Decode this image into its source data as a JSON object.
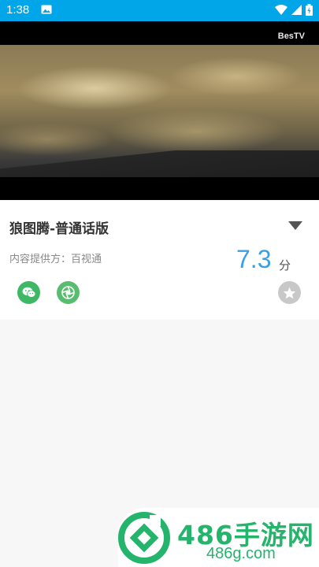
{
  "status_bar": {
    "time": "1:38",
    "bg_color": "#00a6e8",
    "icons": [
      "image-icon",
      "wifi-icon",
      "signal-icon",
      "battery-icon"
    ]
  },
  "video": {
    "logo": "BesTV"
  },
  "info": {
    "title": "狼图腾-普通话版",
    "provider": "内容提供方：百视通",
    "score": "7.3",
    "score_unit": "分",
    "score_color": "#3aa0e6",
    "share_icons": [
      "wechat-icon",
      "moments-icon"
    ],
    "favorite_icon": "star-icon"
  },
  "watermark": {
    "text": "486手游网",
    "subtext": "486g.com",
    "color": "#25b46b"
  }
}
